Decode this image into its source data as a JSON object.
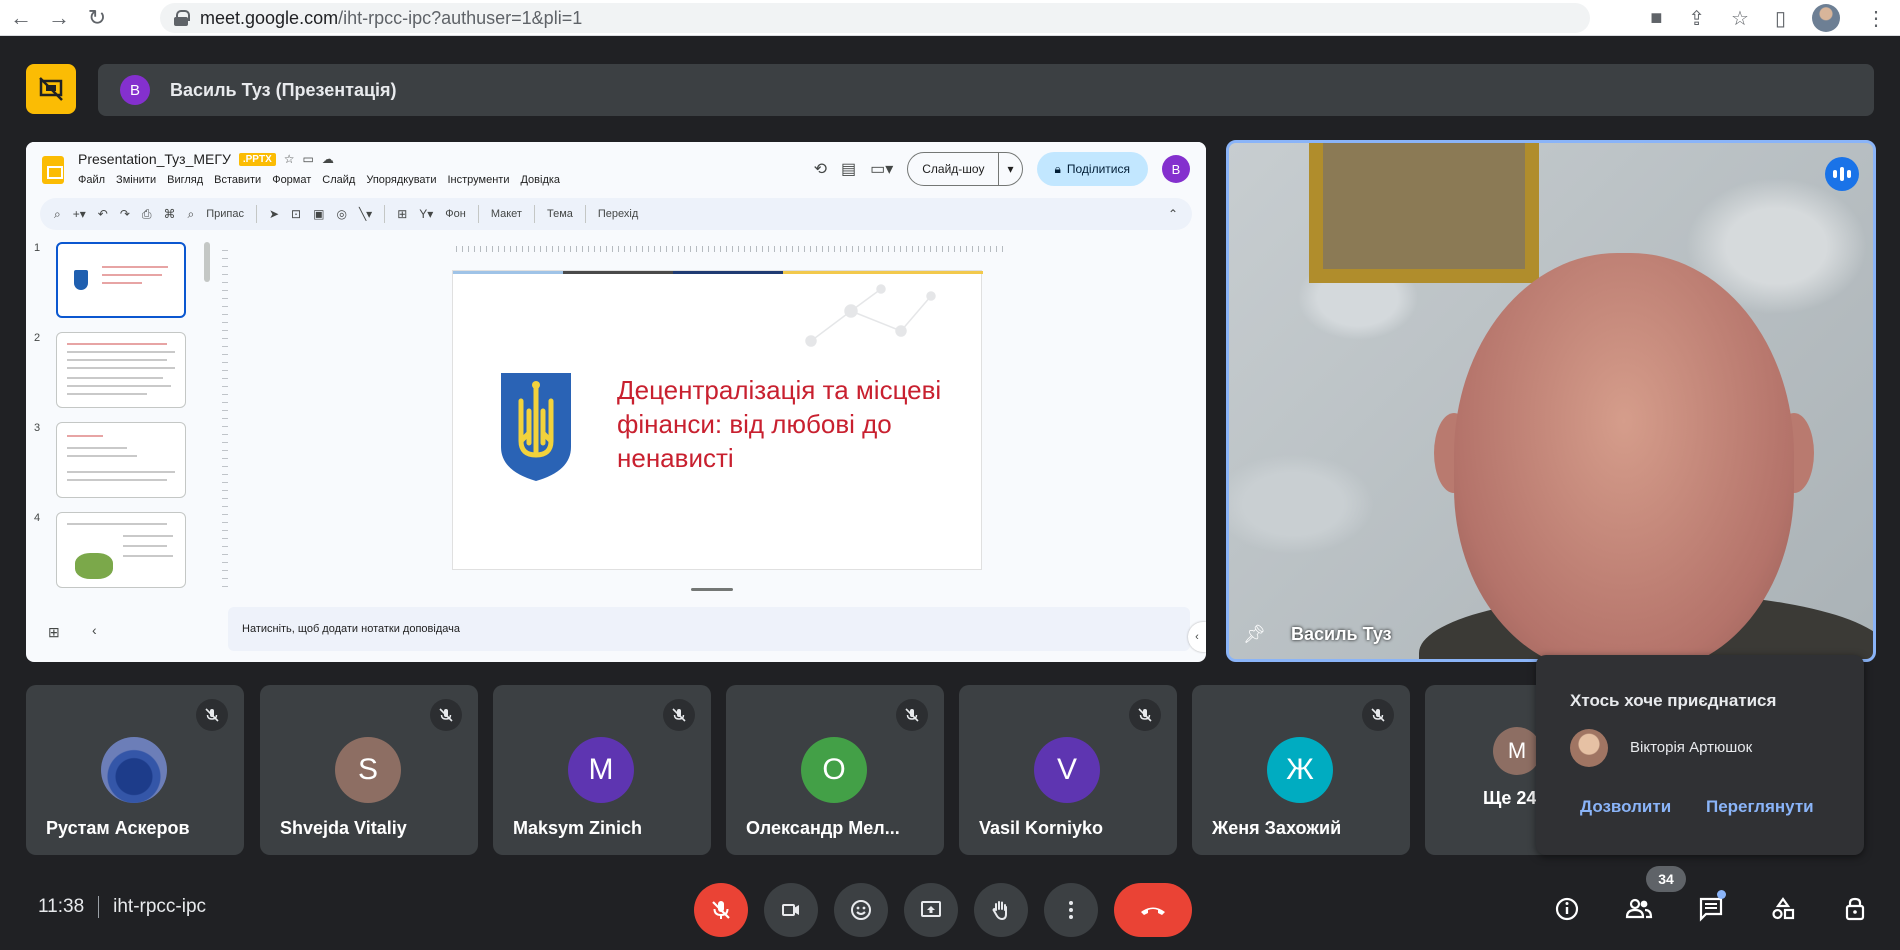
{
  "browser": {
    "url_host": "meet.google.com",
    "url_path": "/iht-rpcc-ipc?authuser=1&pli=1"
  },
  "presenter_bar": {
    "badge": "В",
    "title": "Василь Туз (Презентація)"
  },
  "slides_app": {
    "doc_name": "Presentation_Туз_МЕГУ",
    "file_badge": ".PPTX",
    "menu": [
      "Файл",
      "Змінити",
      "Вигляд",
      "Вставити",
      "Формат",
      "Слайд",
      "Упорядкувати",
      "Інструменти",
      "Довідка"
    ],
    "slideshow_label": "Слайд-шоу",
    "share_label": "Поділитися",
    "user_badge": "В",
    "toolbar": {
      "zoom_label": "Припас",
      "background": "Фон",
      "layout": "Макет",
      "theme": "Тема",
      "transition": "Перехід"
    },
    "thumb_numbers": [
      "1",
      "2",
      "3",
      "4"
    ],
    "slide_title": "Децентралізація та місцеві фінанси: від любові до ненависті",
    "notes_placeholder": "Натисніть, щоб додати нотатки доповідача"
  },
  "video": {
    "name": "Василь Туз"
  },
  "participants": [
    {
      "name": "Рустам Аскеров",
      "initial": "",
      "color": "#3456a8"
    },
    {
      "name": "Shvejda Vitaliy",
      "initial": "S",
      "color": "#8d6e63"
    },
    {
      "name": "Maksym Zinich",
      "initial": "M",
      "color": "#5e35b1"
    },
    {
      "name": "Олександр Мел...",
      "initial": "O",
      "color": "#43a047"
    },
    {
      "name": "Vasil Korniyko",
      "initial": "V",
      "color": "#5e35b1"
    },
    {
      "name": "Женя Захожий",
      "initial": "Ж",
      "color": "#00acc1"
    }
  ],
  "more_tile": {
    "initial": "M",
    "label": "Ще 24"
  },
  "join_popup": {
    "title": "Хтось хоче приєднатися",
    "person": "Вікторія Артюшок",
    "allow": "Дозволити",
    "view": "Переглянути"
  },
  "bottom": {
    "time": "11:38",
    "meeting_code": "iht-rpcc-ipc",
    "participant_count": "34"
  },
  "colors": {
    "meet_bg": "#202124",
    "tile_bg": "#3c4043",
    "accent_blue": "#8ab4f8",
    "end_red": "#ea4335",
    "present_yellow": "#fbbc04"
  }
}
